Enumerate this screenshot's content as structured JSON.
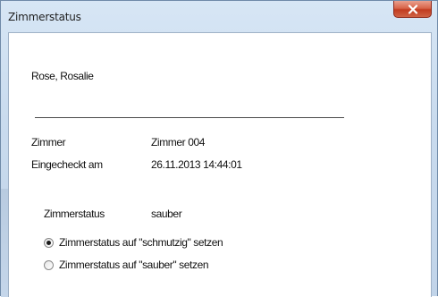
{
  "window": {
    "title": "Zimmerstatus"
  },
  "guest": {
    "name": "Rose, Rosalie"
  },
  "details": {
    "room_label": "Zimmer",
    "room_value": "Zimmer 004",
    "checkin_label": "Eingecheckt am",
    "checkin_value": "26.11.2013 14:44:01",
    "status_label": "Zimmerstatus",
    "status_value": "sauber"
  },
  "options": [
    {
      "label": "Zimmerstatus auf \"schmutzig\" setzen",
      "selected": true
    },
    {
      "label": "Zimmerstatus auf \"sauber\" setzen",
      "selected": false
    }
  ],
  "icons": {
    "close": "close-icon",
    "radio_checked": "radio-checked-icon",
    "radio_unchecked": "radio-unchecked-icon"
  },
  "colors": {
    "titlebar": "#c9dbee",
    "close_button": "#c94a2c",
    "client_background": "#ffffff"
  }
}
